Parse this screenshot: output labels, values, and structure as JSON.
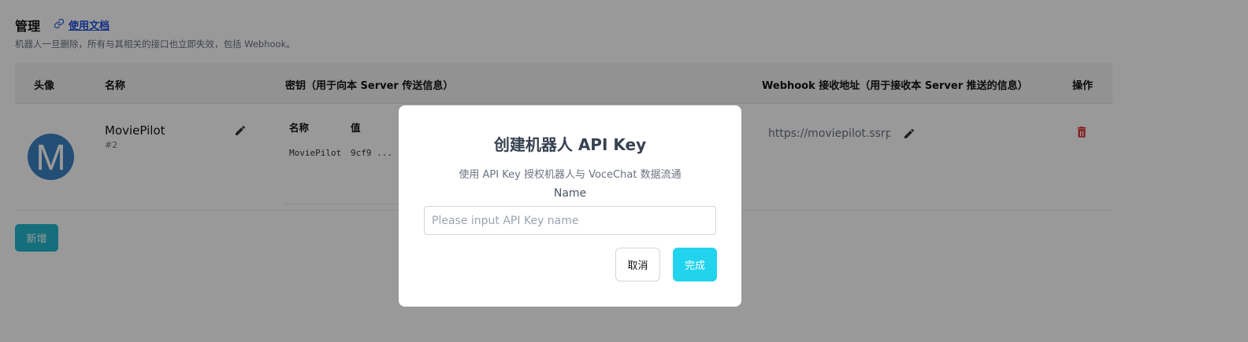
{
  "header": {
    "title": "管理",
    "docs_link": "使用文档",
    "subtitle": "机器人一旦删除，所有与其相关的接口也立即失效，包括 Webhook。"
  },
  "table": {
    "columns": {
      "avatar": "头像",
      "name": "名称",
      "key": "密钥（用于向本 Server 传送信息）",
      "webhook": "Webhook 接收地址（用于接收本 Server 推送的信息）",
      "actions": "操作"
    },
    "rows": [
      {
        "avatar_letter": "M",
        "name": "MoviePilot",
        "id": "#2",
        "keys": {
          "columns": {
            "name": "名称",
            "value": "值"
          },
          "items": [
            {
              "name": "MoviePilot",
              "value": "9cf9 ..."
            }
          ]
        },
        "webhook_url": "https://moviepilot.ssrpi"
      }
    ]
  },
  "add_button": "新增",
  "modal": {
    "title": "创建机器人 API Key",
    "description": "使用 API Key 授权机器人与 VoceChat 数据流通",
    "field_label": "Name",
    "input_placeholder": "Please input API Key name",
    "input_value": "",
    "cancel_label": "取消",
    "done_label": "完成"
  },
  "colors": {
    "accent": "#22d3ee",
    "add_button": "#22b8cf",
    "avatar": "#3b82c4",
    "danger": "#dc2626",
    "link": "#1d4ed8"
  },
  "icons": {
    "docs": "link-icon",
    "edit": "pencil-icon",
    "delete": "trash-icon"
  }
}
